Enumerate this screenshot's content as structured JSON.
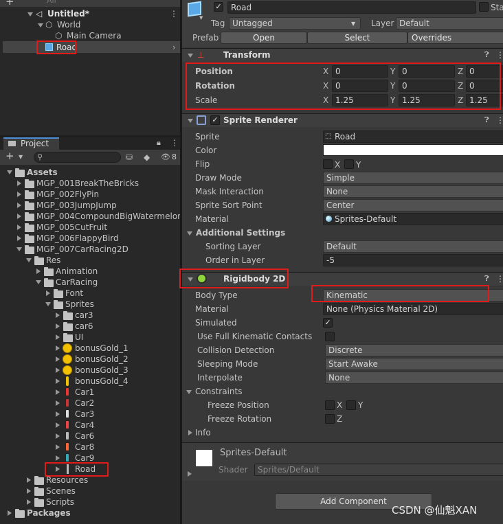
{
  "hierarchy": {
    "search_placeholder": "All",
    "scene": "Untitled*",
    "items": [
      "World",
      "Main Camera",
      "Road"
    ]
  },
  "project": {
    "tab": "Project",
    "badge": "8",
    "tree": [
      "Assets",
      "MGP_001BreakTheBricks",
      "MGP_002FlyPin",
      "MGP_003JumpJump",
      "MGP_004CompoundBigWatermelon",
      "MGP_005CutFruit",
      "MGP_006FlappyBird",
      "MGP_007CarRacing2D",
      "Res",
      "Animation",
      "CarRacing",
      "Font",
      "Sprites",
      "car3",
      "car6",
      "UI",
      "bonusGold_1",
      "bonusGold_2",
      "bonusGold_3",
      "bonusGold_4",
      "Car1",
      "Car2",
      "Car3",
      "Car4",
      "Car6",
      "Car8",
      "Car9",
      "Road",
      "Resources",
      "Scenes",
      "Scripts",
      "Packages"
    ]
  },
  "inspector": {
    "name": "Road",
    "static_label": "Sta",
    "tag_label": "Tag",
    "tag": "Untagged",
    "layer_label": "Layer",
    "layer": "Default",
    "prefab_label": "Prefab",
    "prefab_open": "Open",
    "prefab_select": "Select",
    "prefab_overrides": "Overrides",
    "transform": {
      "title": "Transform",
      "rows": [
        {
          "label": "Position",
          "x": "0",
          "y": "0",
          "z": "0"
        },
        {
          "label": "Rotation",
          "x": "0",
          "y": "0",
          "z": "0"
        },
        {
          "label": "Scale",
          "x": "1.25",
          "y": "1.25",
          "z": "1.25"
        }
      ],
      "axis_x": "X",
      "axis_y": "Y",
      "axis_z": "Z"
    },
    "sprite_renderer": {
      "title": "Sprite Renderer",
      "sprite_label": "Sprite",
      "sprite": "Road",
      "color_label": "Color",
      "color": "#ffffff",
      "flip_label": "Flip",
      "flip_x": "X",
      "flip_y": "Y",
      "draw_mode_label": "Draw Mode",
      "draw_mode": "Simple",
      "mask_label": "Mask Interaction",
      "mask": "None",
      "sort_point_label": "Sprite Sort Point",
      "sort_point": "Center",
      "material_label": "Material",
      "material": "Sprites-Default",
      "additional": "Additional Settings",
      "sorting_layer_label": "Sorting Layer",
      "sorting_layer": "Default",
      "order_label": "Order in Layer",
      "order": "-5"
    },
    "rigidbody": {
      "title": "Rigidbody 2D",
      "body_type_label": "Body Type",
      "body_type": "Kinematic",
      "material_label": "Material",
      "material": "None (Physics Material 2D)",
      "simulated_label": "Simulated",
      "full_contacts_label": "Use Full Kinematic Contacts",
      "collision_label": "Collision Detection",
      "collision": "Discrete",
      "sleeping_label": "Sleeping Mode",
      "sleeping": "Start Awake",
      "interpolate_label": "Interpolate",
      "interpolate": "None",
      "constraints_label": "Constraints",
      "freeze_pos_label": "Freeze Position",
      "freeze_rot_label": "Freeze Rotation",
      "axis_x": "X",
      "axis_y": "Y",
      "axis_z": "Z",
      "info_label": "Info"
    },
    "material_preview": {
      "name": "Sprites-Default",
      "shader_label": "Shader",
      "shader": "Sprites/Default"
    },
    "add_component": "Add Component"
  },
  "watermark": "CSDN @仙魁XAN"
}
